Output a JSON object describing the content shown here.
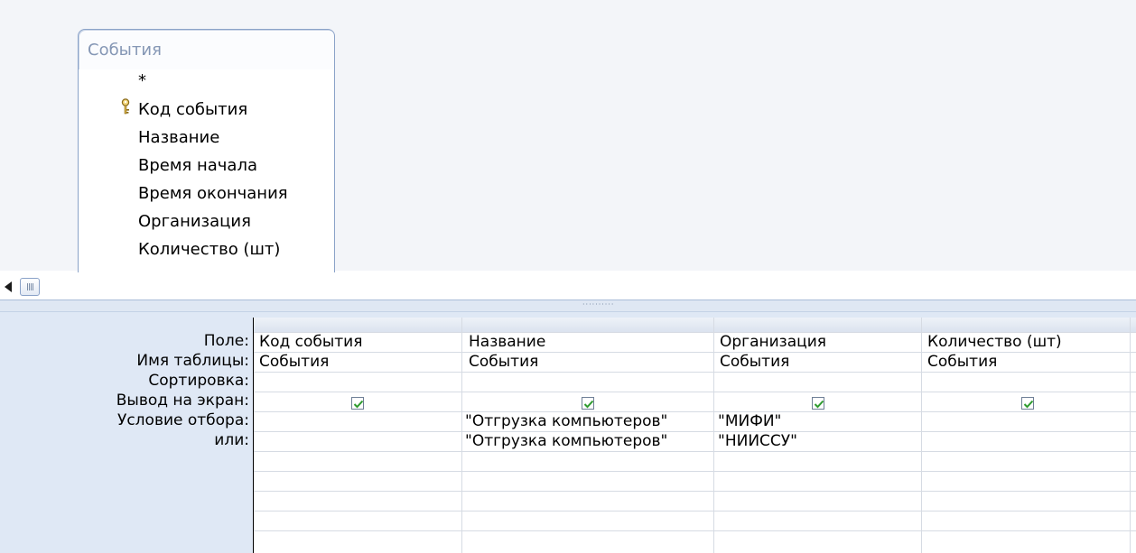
{
  "table": {
    "title": "События",
    "fields": [
      "*",
      "Код события",
      "Название",
      "Время начала",
      "Время окончания",
      "Организация",
      "Количество (шт)"
    ],
    "key_field_index": 1
  },
  "grid": {
    "row_labels": [
      "Поле:",
      "Имя таблицы:",
      "Сортировка:",
      "Вывод на экран:",
      "Условие отбора:",
      "или:"
    ],
    "columns": [
      {
        "field": "Код события",
        "table": "События",
        "sort": "",
        "show": true,
        "criteria": "",
        "or": ""
      },
      {
        "field": "Название",
        "table": "События",
        "sort": "",
        "show": true,
        "criteria": "\"Отгрузка компьютеров\"",
        "or": "\"Отгрузка компьютеров\""
      },
      {
        "field": "Организация",
        "table": "События",
        "sort": "",
        "show": true,
        "criteria": "\"МИФИ\"",
        "or": "\"НИИССУ\""
      },
      {
        "field": "Количество (шт)",
        "table": "События",
        "sort": "",
        "show": true,
        "criteria": "",
        "or": ""
      }
    ]
  },
  "colors": {
    "design_bg": "#f3f5f9",
    "grid_bg": "#dfe8f5",
    "check_color": "#2e9b2e"
  },
  "icons": {
    "key": "key-icon",
    "scroll_left": "arrow-left-icon",
    "checkbox": "checkbox-checked-icon"
  }
}
